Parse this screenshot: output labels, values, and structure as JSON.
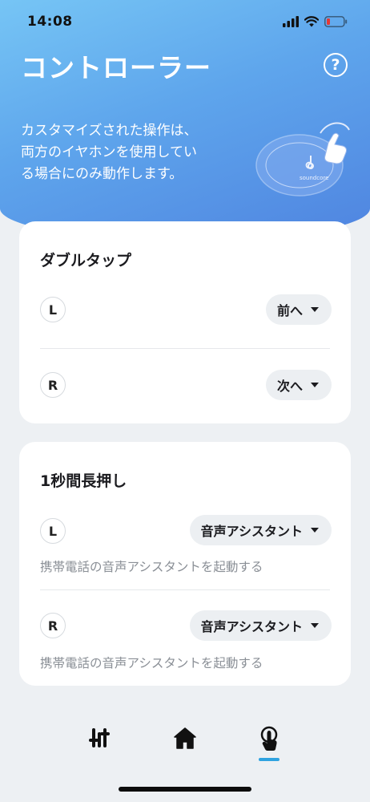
{
  "status_bar": {
    "time": "14:08"
  },
  "header": {
    "title": "コントローラー",
    "help_icon": "question-circle-icon",
    "description_lines": [
      "カスタマイズされた操作は、",
      "両方のイヤホンを使用してい",
      "る場合にのみ動作します。"
    ],
    "illustration_brand": "soundcore"
  },
  "double_tap": {
    "title": "ダブルタップ",
    "left": {
      "side": "L",
      "value": "前へ"
    },
    "right": {
      "side": "R",
      "value": "次へ"
    }
  },
  "long_press": {
    "title": "1秒間長押し",
    "left": {
      "side": "L",
      "value": "音声アシスタント",
      "description": "携帯電話の音声アシスタントを起動する"
    },
    "right": {
      "side": "R",
      "value": "音声アシスタント",
      "description": "携帯電話の音声アシスタントを起動する"
    }
  },
  "tab_bar": {
    "tabs": [
      {
        "icon": "equalizer-sliders-icon",
        "active": false
      },
      {
        "icon": "home-icon",
        "active": false
      },
      {
        "icon": "touch-control-icon",
        "active": true
      }
    ],
    "accent_color": "#2fa3e0"
  }
}
